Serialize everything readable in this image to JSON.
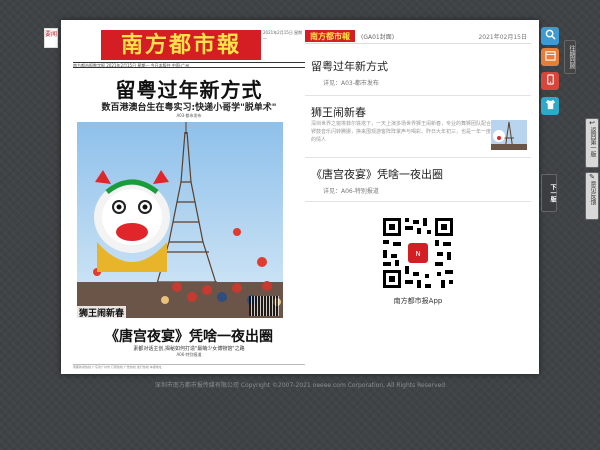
{
  "left_tab": {
    "label": "要闻"
  },
  "front_page": {
    "masthead": "南方都市報",
    "masthead_meta": "2021年2月15日 星期一",
    "dateline": "南方都市报数字报  2021年2月15日  星期一  今日本版共  中国·广州",
    "headline": "留粤过年新方式",
    "subhead": "数百港澳台生在粤实习:快递小哥学\"脱单术\"",
    "headline_ref": "A03·都市发布",
    "photo_caption": "狮王闹新春",
    "headline2": "《唐宫夜宴》凭啥一夜出圈",
    "subhead2": "素都对话主创,揭秘如何打造\"最萌少女博物馆\"之路",
    "headline2_ref": "A06·特别报道",
    "footer": "南都新闻热线  广东省广州市  订阅热线  广告热线  发行热线  本报地址"
  },
  "index": {
    "logo": "南方都市報",
    "page_name": "(GA01封面)",
    "date": "2021年02月15日",
    "articles": [
      {
        "title": "留粤过年新方式",
        "meta": "详见：A03-都市发布"
      },
      {
        "title": "狮王闹新春",
        "body": "深圳世界之窗埃菲尔铁塔下，一天上演多场世界狮王闹新春，专业的舞狮团队配合锣鼓音乐闪转腾挪，换来围观游客阵阵掌声与喝彩。昨日大年初三，也是一年一度的情人"
      },
      {
        "title": "《唐宫夜宴》凭啥一夜出圈",
        "meta": "详见：A06-特别报道"
      }
    ],
    "qr_label": "南方都市报App"
  },
  "toolbar": {
    "past_issues": "往期回顾",
    "back_to_list": "返回第一版",
    "next_page": "下一版",
    "feedback": "意见反馈"
  },
  "copyright": "深圳市南方都市报传媒有限公司 Copyright ©2007-2021 oeeee.com Corporation, All Rights Reserved",
  "colors": {
    "brand_red": "#d51d24",
    "masthead_yellow": "#ffe24a"
  },
  "icons": [
    "search-icon",
    "calendar-icon",
    "mobile-icon",
    "shirt-icon",
    "arrow-back-icon",
    "edit-icon"
  ]
}
